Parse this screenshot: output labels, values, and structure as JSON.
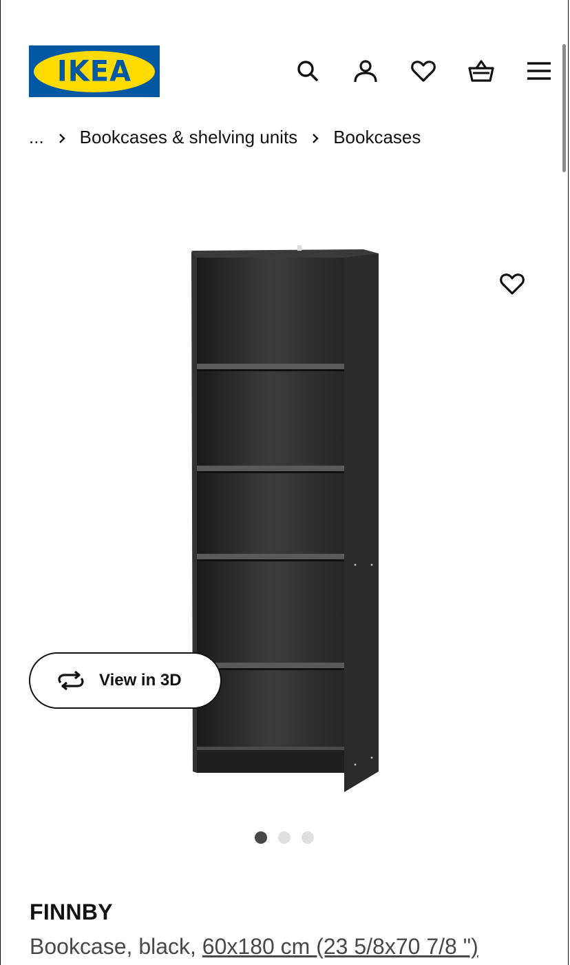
{
  "brand": {
    "logo_text": "IKEA",
    "colors": {
      "blue": "#0058a3",
      "yellow": "#ffdb00"
    }
  },
  "header": {
    "icons": [
      "search-icon",
      "account-icon",
      "heart-icon",
      "basket-icon",
      "menu-icon"
    ]
  },
  "breadcrumb": {
    "ellipsis": "...",
    "items": [
      "Bookcases & shelving units",
      "Bookcases"
    ]
  },
  "gallery": {
    "view3d_label": "View in 3D",
    "image_count": 3,
    "active_image": 1
  },
  "product": {
    "name": "FINNBY",
    "description_prefix": "Bookcase, black, ",
    "size": "60x180 cm (23 5/8x70 7/8 \")"
  }
}
